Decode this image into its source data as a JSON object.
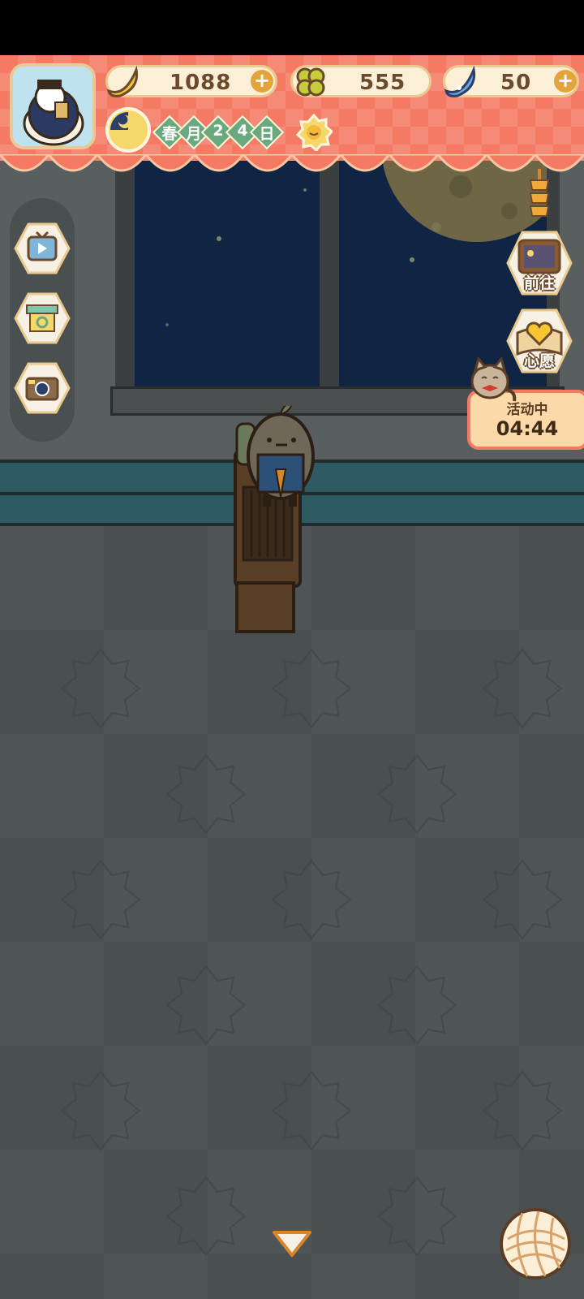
{
  "currencies": {
    "banana": {
      "icon": "banana-icon",
      "value": "1088",
      "plus": "+"
    },
    "clover": {
      "icon": "clover-icon",
      "value": "555"
    },
    "gem": {
      "icon": "blue-banana-icon",
      "value": "50",
      "plus": "+"
    }
  },
  "date": {
    "season": "春",
    "month_label": "月",
    "day_digits": [
      "2",
      "4"
    ],
    "day_label": "日",
    "time_icon": "moon-night-icon",
    "weather_icon": "sun-icon"
  },
  "left_buttons": [
    {
      "icon": "tv-play-icon"
    },
    {
      "icon": "shop-stall-icon"
    },
    {
      "icon": "camera-icon"
    }
  ],
  "right_buttons": {
    "go": {
      "icon": "notice-board-icon",
      "label": "前往"
    },
    "wish": {
      "icon": "heart-book-icon",
      "label": "心愿"
    }
  },
  "event": {
    "label": "活动中",
    "timer": "04:44"
  },
  "bottom": {
    "expand_icon": "chevron-down-icon",
    "menu_icon": "yarn-ball-icon"
  },
  "colors": {
    "banner": "#f47a63",
    "wall": "#595f60",
    "floor": "#4f5556",
    "window_night": "#102544",
    "date_green": "#6aa97d"
  }
}
